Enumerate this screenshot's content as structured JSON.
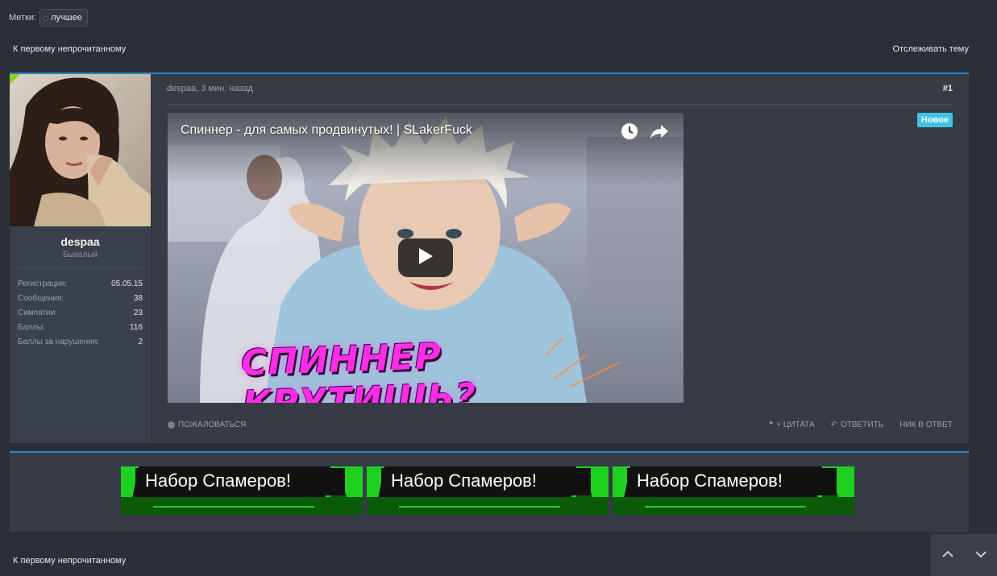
{
  "tags": {
    "label": "Метки:",
    "items": [
      "лучшее"
    ]
  },
  "nav": {
    "first_unread": "К первому непрочитанному",
    "watch": "Отслеживать тему"
  },
  "post": {
    "author": "despaa",
    "meta": "despaa, 3 мин. назад",
    "number": "#1",
    "new_badge": "Новое",
    "user": {
      "name": "despaa",
      "title": "Бывалый",
      "stats": [
        {
          "k": "Регистрация:",
          "v": "05.05.15"
        },
        {
          "k": "Сообщения:",
          "v": "38"
        },
        {
          "k": "Симпатии:",
          "v": "23"
        },
        {
          "k": "Баллы:",
          "v": "116"
        },
        {
          "k": "Баллы за нарушения:",
          "v": "2"
        }
      ]
    },
    "video": {
      "title": "Спиннер - для самых продвинутых! | SLakerFuck",
      "caption": "СПИННЕР КРУТИШЬ?"
    },
    "actions": {
      "report": "ПОЖАЛОВАТЬСЯ",
      "quote": "+ ЦИТАТА",
      "reply": "ОТВЕТИТЬ",
      "nick": "НИК В ОТВЕТ"
    }
  },
  "banners": [
    {
      "text": "Набор Спамеров!"
    },
    {
      "text": "Набор Спамеров!"
    },
    {
      "text": "Набор Спамеров!"
    }
  ],
  "colors": {
    "accent": "#2a84c9",
    "new_badge": "#3ec4e0",
    "banner_green": "#1fd11f"
  }
}
